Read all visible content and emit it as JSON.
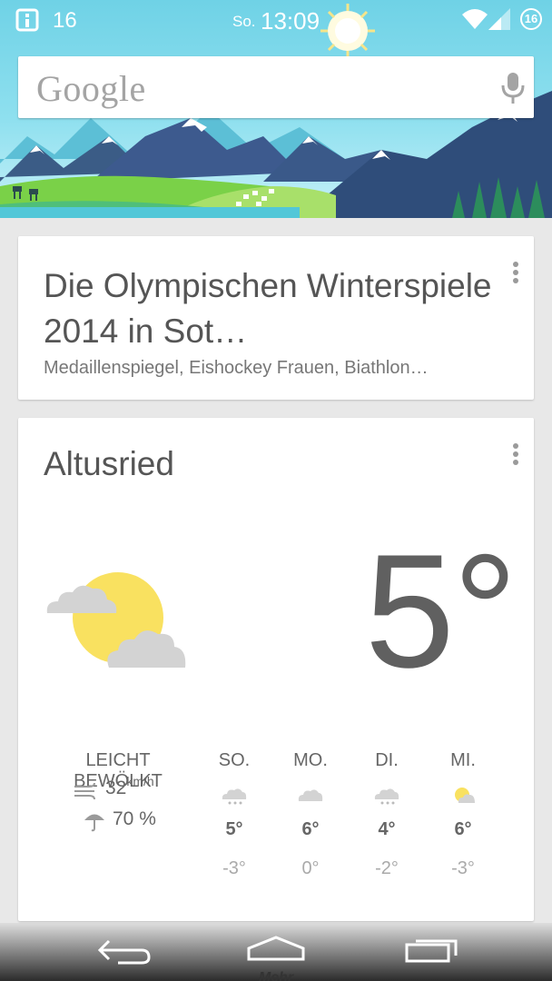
{
  "status_bar": {
    "notification_count": "16",
    "day": "So.",
    "time": "13:09",
    "battery": "16"
  },
  "search": {
    "logo_text": "Google",
    "mic_icon": "microphone-icon"
  },
  "news_card": {
    "title": "Die Olympischen Winterspiele 2014 in Sot…",
    "subtitle": "Medaillenspiegel, Eishockey Frauen, Biathlon…"
  },
  "weather_card": {
    "location": "Altusried",
    "temperature": "5°",
    "condition": "LEICHT BEWÖLKT",
    "wind_value": "32",
    "wind_unit": "km/h",
    "rain": "70 %",
    "forecast": [
      {
        "day": "SO.",
        "high": "5°",
        "low": "-3°",
        "icon": "snow-cloud-icon"
      },
      {
        "day": "MO.",
        "high": "6°",
        "low": "0°",
        "icon": "cloud-icon"
      },
      {
        "day": "DI.",
        "high": "4°",
        "low": "-2°",
        "icon": "snow-cloud-icon"
      },
      {
        "day": "MI.",
        "high": "6°",
        "low": "-3°",
        "icon": "partly-sunny-icon"
      }
    ]
  },
  "nav_bar": {
    "more_label": "Mehr"
  },
  "colors": {
    "sky": "#8fe0ef",
    "sun": "#f9e160",
    "card_bg": "#ffffff",
    "page_bg": "#e8e8e8",
    "text_primary": "#555555"
  }
}
